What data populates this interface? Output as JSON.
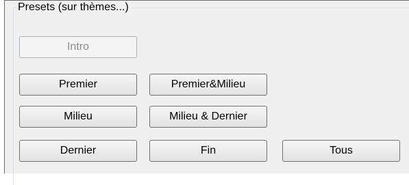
{
  "group": {
    "legend": "Presets (sur thèmes...)"
  },
  "buttons": {
    "intro": {
      "label": "Intro",
      "enabled": false
    },
    "premier": {
      "label": "Premier"
    },
    "premier_milieu": {
      "label": "Premier&Milieu"
    },
    "milieu": {
      "label": "Milieu"
    },
    "milieu_dernier": {
      "label": "Milieu & Dernier"
    },
    "dernier": {
      "label": "Dernier"
    },
    "fin": {
      "label": "Fin"
    },
    "tous": {
      "label": "Tous"
    }
  }
}
